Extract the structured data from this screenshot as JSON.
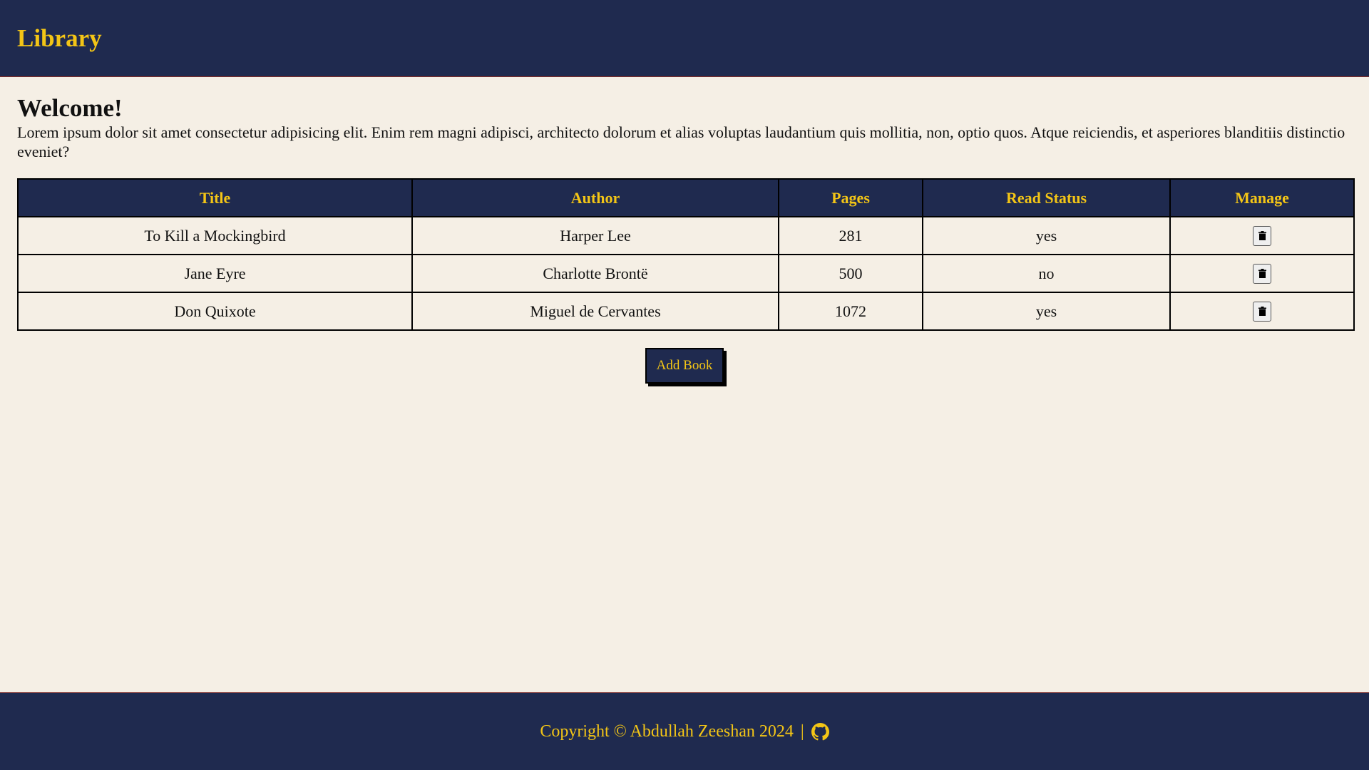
{
  "header": {
    "title": "Library"
  },
  "main": {
    "welcome": "Welcome!",
    "intro": "Lorem ipsum dolor sit amet consectetur adipisicing elit. Enim rem magni adipisci, architecto dolorum et alias voluptas laudantium quis mollitia, non, optio quos. Atque reiciendis, et asperiores blanditiis distinctio eveniet?"
  },
  "table": {
    "headers": {
      "title": "Title",
      "author": "Author",
      "pages": "Pages",
      "read_status": "Read Status",
      "manage": "Manage"
    },
    "rows": [
      {
        "title": "To Kill a Mockingbird",
        "author": "Harper Lee",
        "pages": "281",
        "read_status": "yes"
      },
      {
        "title": "Jane Eyre",
        "author": "Charlotte Brontë",
        "pages": "500",
        "read_status": "no"
      },
      {
        "title": "Don Quixote",
        "author": "Miguel de Cervantes",
        "pages": "1072",
        "read_status": "yes"
      }
    ],
    "manage_icon": "trash-icon"
  },
  "actions": {
    "add_book_label": "Add Book"
  },
  "footer": {
    "copyright": "Copyright © Abdullah Zeeshan 2024",
    "separator": "|",
    "github_icon": "github-icon"
  },
  "colors": {
    "navy": "#1f2a4f",
    "gold": "#f3c516",
    "background": "#f5efe5"
  }
}
